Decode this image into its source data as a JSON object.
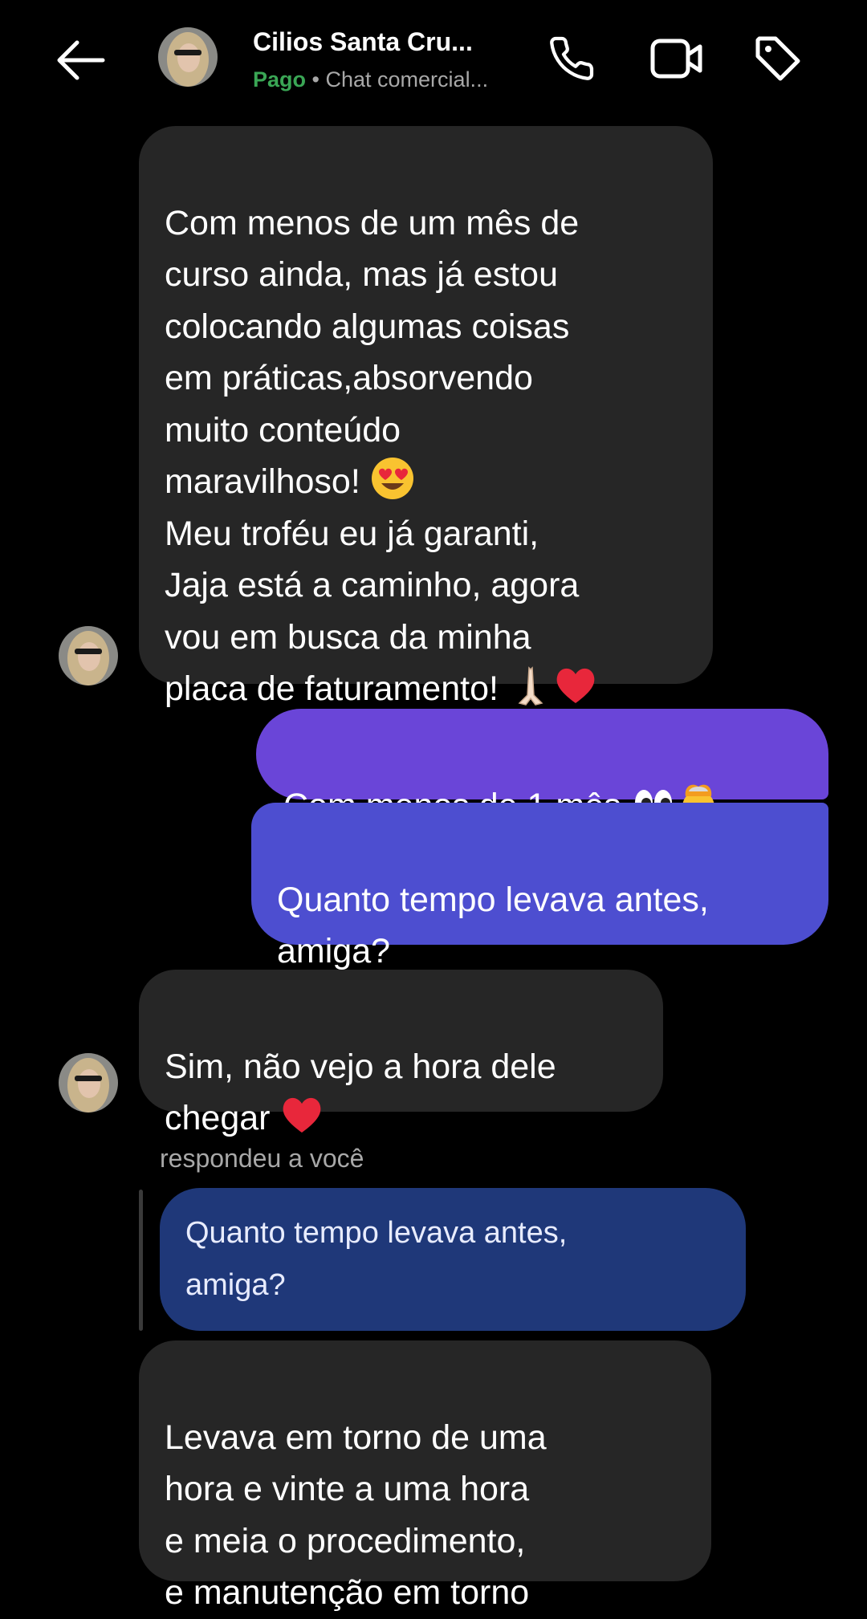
{
  "header": {
    "contact_name": "Cilios Santa Cru...",
    "status_paid": "Pago",
    "separator": "•",
    "chat_type": "Chat comercial..."
  },
  "icons": {
    "back": "arrow-left",
    "call": "phone",
    "video": "video-camera",
    "label": "tag"
  },
  "colors": {
    "background": "#000000",
    "incoming_bubble": "#262626",
    "outgoing_top": "#6a45d8",
    "outgoing_bottom": "#4d4ed0",
    "reply_quote": "#1f3879",
    "paid_green": "#3aa655"
  },
  "messages": [
    {
      "id": "m1",
      "direction": "incoming",
      "text": "Com menos de um mês de\ncurso ainda, mas já estou\ncolocando algumas coisas\nem práticas,absorvendo\nmuito conteúdo\nmaravilhoso! ",
      "text2": "\nMeu troféu eu já garanti,\nJaja está a caminho, agora\nvou em busca da minha\nplaca de faturamento! ",
      "emojis": [
        "smiling-face-with-heart-eyes",
        "folded-hands",
        "red-heart"
      ]
    },
    {
      "id": "m2",
      "direction": "outgoing",
      "text": "Com menos de 1 mês ",
      "emojis": [
        "eyes",
        "exploding-head"
      ]
    },
    {
      "id": "m3",
      "direction": "outgoing",
      "text": "Quanto tempo levava antes,\namiga?"
    },
    {
      "id": "m4",
      "direction": "incoming",
      "text": "Sim, não vejo a hora dele\nchegar ",
      "emojis": [
        "red-heart"
      ]
    },
    {
      "id": "m5",
      "direction": "incoming",
      "reply_label": "respondeu a você",
      "quoted_text": "Quanto tempo levava antes,\namiga?",
      "text": "Levava em torno de uma\nhora e vinte a uma hora\ne meia o procedimento,\ne manutenção em torno"
    }
  ]
}
